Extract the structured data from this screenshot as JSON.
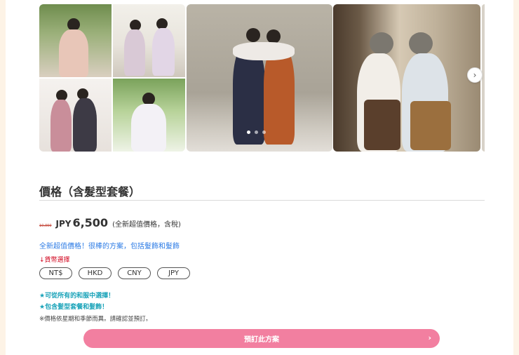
{
  "section": {
    "title": "價格（含髮型套餐）"
  },
  "price": {
    "old": "10,000",
    "currency": "JPY",
    "amount": "6,500",
    "note": "(全新超值價格，含稅)"
  },
  "promo_text": "全新超值價格！很棒的方案，包括髮飾和髮飾",
  "currency_select": {
    "label": "↓貨幣選擇",
    "options": [
      "NT$",
      "HKD",
      "CNY",
      "JPY"
    ]
  },
  "features": [
    "★可從所有的和服中選擇！",
    "★包含髮型套餐和髮飾！"
  ],
  "disclaimer": "※價格依星期和季節而異。請確認並預訂。",
  "book": {
    "label": "預訂此方案",
    "arrow": "›"
  },
  "gallery": {
    "next_icon": "›",
    "icon_names": [
      "chevron-right-icon"
    ],
    "active_slide": 1,
    "slide_count": 3
  },
  "colors": {
    "accent_pink": "#f27fa0",
    "link_blue": "#2c7be5",
    "feature_teal": "#17a2b8",
    "alert_red": "#d0021b"
  }
}
